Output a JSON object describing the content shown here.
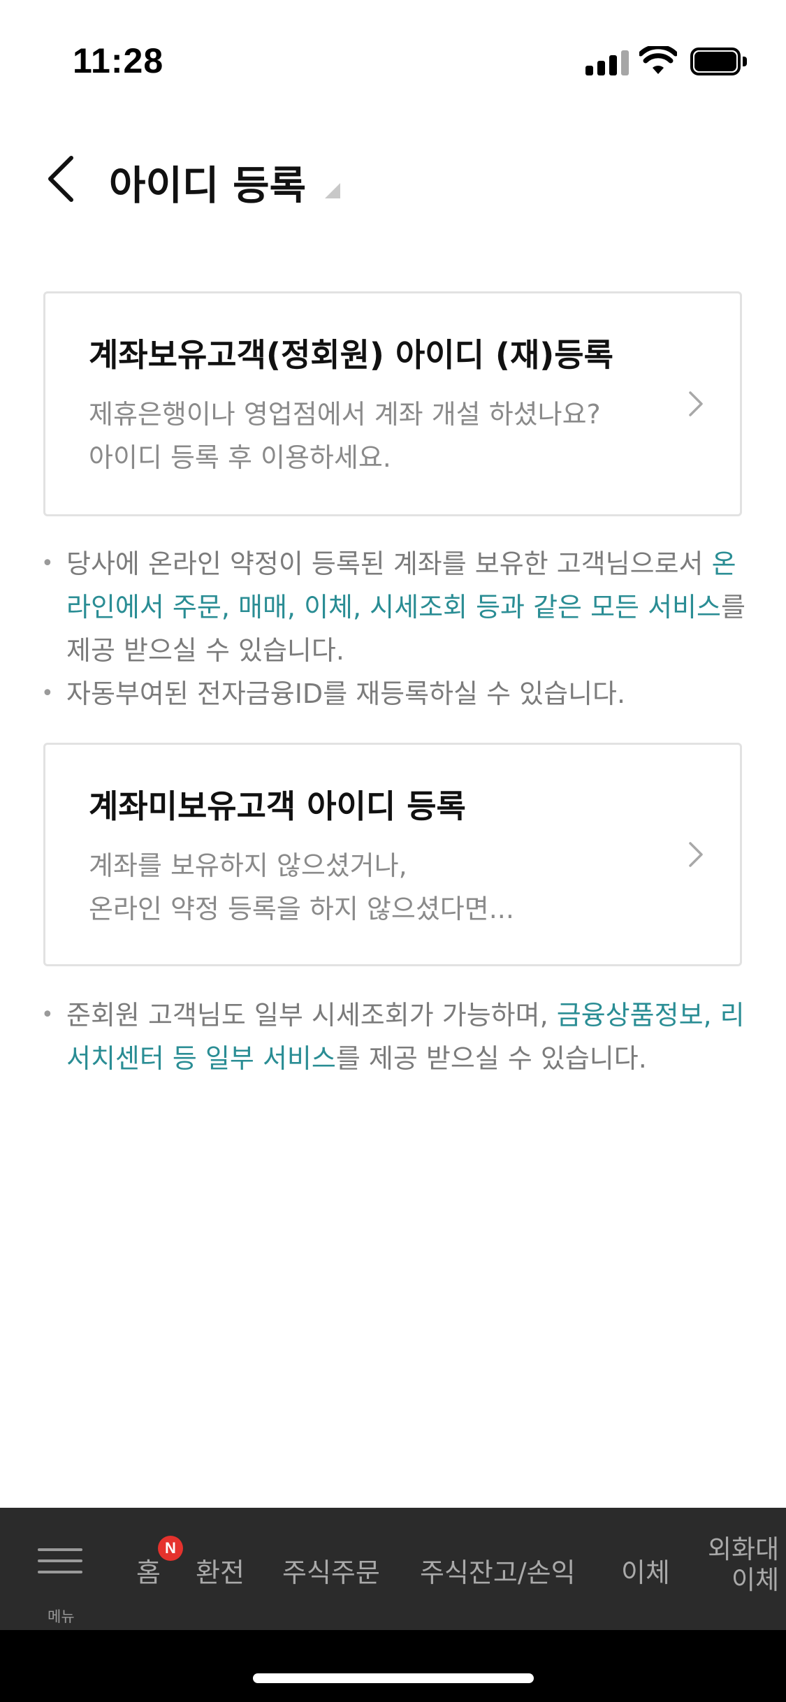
{
  "status_bar": {
    "time": "11:28",
    "icons": [
      "cellular-signal-icon",
      "wifi-icon",
      "battery-icon"
    ]
  },
  "header": {
    "title": "아이디 등록",
    "back_icon": "chevron-left-icon"
  },
  "cards": [
    {
      "title": "계좌보유고객(정회원) 아이디 (재)등록",
      "desc_lines": [
        "제휴은행이나 영업점에서 계좌 개설 하셨나요?",
        "아이디 등록 후 이용하세요."
      ]
    },
    {
      "title": "계좌미보유고객 아이디 등록",
      "desc_lines": [
        "계좌를 보유하지 않으셨거나,",
        "온라인 약정 등록을 하지 않으셨다면..."
      ]
    }
  ],
  "notes_1": [
    {
      "pre": "당사에 온라인 약정이 등록된 계좌를 보유한 고객님으로서 ",
      "highlight": "온라인에서 주문, 매매, 이체, 시세조회 등과 같은 모든 서비스",
      "post": "를 제공 받으실 수 있습니다."
    },
    {
      "text": "자동부여된 전자금융ID를 재등록하실 수 있습니다."
    }
  ],
  "notes_2": [
    {
      "pre": "준회원 고객님도 일부 시세조회가 가능하며, ",
      "highlight": "금융상품정보, 리서치센터 등 일부 서비스",
      "post": "를 제공 받으실 수 있습니다."
    }
  ],
  "bottom_nav": {
    "menu_label": "메뉴",
    "badge": "N",
    "items": [
      "홈",
      "환전",
      "주식주문",
      "주식잔고/손익",
      "이체"
    ],
    "last_item_lines": [
      "외화대",
      "이체"
    ]
  },
  "colors": {
    "highlight": "#2a8d94",
    "nav_bg": "#2b2b2b",
    "badge": "#e5322d"
  }
}
